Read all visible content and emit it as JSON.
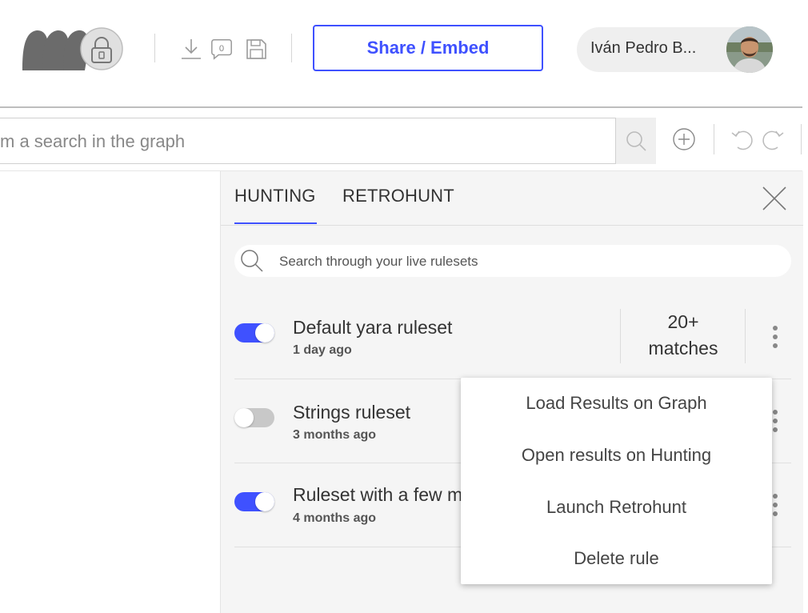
{
  "header": {
    "share_label": "Share / Embed",
    "user_name": "Iván Pedro B...",
    "icons": [
      "collaborators-avatars",
      "lock-icon",
      "download-icon",
      "comment-icon",
      "save-icon"
    ],
    "comment_count": "0"
  },
  "search": {
    "placeholder": "m a search in the graph"
  },
  "toolbar_icons": [
    "search-icon",
    "add-icon",
    "undo-icon",
    "redo-icon"
  ],
  "panel": {
    "tabs": [
      {
        "label": "HUNTING",
        "active": true
      },
      {
        "label": "RETROHUNT",
        "active": false
      }
    ],
    "search_placeholder": "Search through your live rulesets",
    "rules": [
      {
        "name": "Default yara ruleset",
        "time": "1 day ago",
        "enabled": true,
        "matches_line1": "20+",
        "matches_line2": "matches"
      },
      {
        "name": "Strings ruleset",
        "time": "3 months ago",
        "enabled": false
      },
      {
        "name": "Ruleset with a few m",
        "time": "4 months ago",
        "enabled": true
      }
    ]
  },
  "context_menu": {
    "items": [
      "Load Results on Graph",
      "Open results on Hunting",
      "Launch Retrohunt",
      "Delete rule"
    ]
  },
  "colors": {
    "accent": "#3f51ff",
    "toggle_on": "#3f51ff",
    "toggle_off": "#c8c8c8",
    "panel_bg": "#f5f5f5"
  }
}
